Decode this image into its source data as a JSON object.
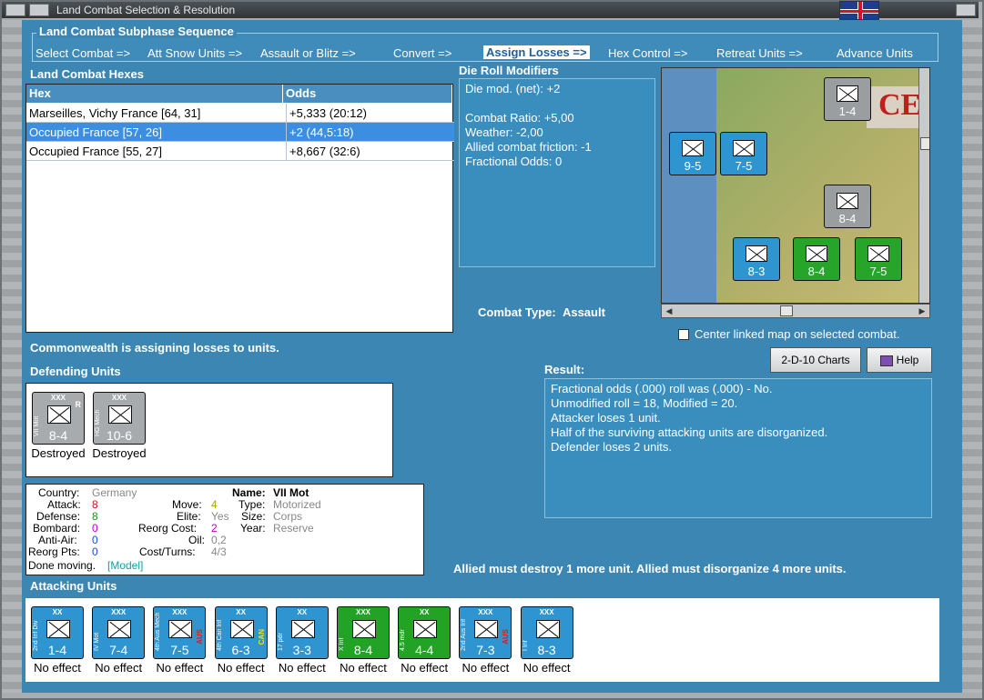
{
  "window": {
    "title": "Land Combat Selection & Resolution"
  },
  "sequence": {
    "title": "Land Combat Subphase Sequence",
    "steps": [
      "Select Combat =>",
      "Att Snow Units =>",
      "Assault or Blitz =>",
      "Convert =>",
      "Assign Losses =>",
      "Hex Control =>",
      "Retreat Units =>",
      "Advance Units"
    ],
    "active_index": 4
  },
  "hexes": {
    "title": "Land Combat Hexes",
    "columns": [
      "Hex",
      "Odds"
    ],
    "rows": [
      {
        "hex": "Marseilles, Vichy France [64, 31]",
        "odds": "+5,333 (20:12)",
        "selected": false
      },
      {
        "hex": "Occupied France [57, 26]",
        "odds": "+2 (44,5:18)",
        "selected": true
      },
      {
        "hex": "Occupied France [55, 27]",
        "odds": "+8,667 (32:6)",
        "selected": false
      }
    ]
  },
  "die": {
    "title": "Die Roll Modifiers",
    "lines": [
      "Die mod. (net): +2",
      "",
      "Combat Ratio: +5,00",
      "Weather: -2,00",
      "Allied combat friction: -1",
      "Fractional Odds: 0"
    ]
  },
  "combat_type": {
    "label": "Combat Type:",
    "value": "Assault"
  },
  "center_map": {
    "label": "Center linked map on selected combat.",
    "checked": false
  },
  "buttons": {
    "charts": "2-D-10 Charts",
    "help": "Help"
  },
  "status_msg": "Commonwealth is assigning losses to units.",
  "result": {
    "title": "Result:",
    "lines": [
      "Fractional odds (.000) roll was (.000)  - No.",
      "Unmodified roll = 18, Modified = 20.",
      "Attacker loses 1 unit.",
      "Half of the surviving attacking units are disorganized.",
      "Defender loses 2 units."
    ]
  },
  "defending": {
    "title": "Defending Units",
    "units": [
      {
        "name": "VII Mot",
        "size": "XXX",
        "value": "8-4",
        "status": "Destroyed",
        "tag": "R"
      },
      {
        "name": "HG Mech",
        "size": "XXX",
        "value": "10-6",
        "status": "Destroyed",
        "tag": ""
      }
    ]
  },
  "info": {
    "country_label": "Country:",
    "country": "Germany",
    "attack_label": "Attack:",
    "attack": "8",
    "defense_label": "Defense:",
    "defense": "8",
    "bombard_label": "Bombard:",
    "bombard": "0",
    "antiair_label": "Anti-Air:",
    "antiair": "0",
    "reorgpts_label": "Reorg Pts:",
    "reorgpts": "0",
    "move_label": "Move:",
    "move": "4",
    "elite_label": "Elite:",
    "elite": "Yes",
    "reorgcost_label": "Reorg Cost:",
    "reorgcost": "2",
    "oil_label": "Oil:",
    "oil": "0,2",
    "costturns_label": "Cost/Turns:",
    "costturns": "4/3",
    "name_label": "Name:",
    "name": "VII Mot",
    "type_label": "Type:",
    "type": "Motorized",
    "size_label": "Size:",
    "size": "Corps",
    "year_label": "Year:",
    "year": "Reserve",
    "done": "Done moving.",
    "model": "[Model]"
  },
  "must_msg": "Allied must destroy 1 more unit. Allied must disorganize 4 more units.",
  "attacking": {
    "title": "Attacking Units",
    "units": [
      {
        "name": "2nd Inf Div",
        "size": "XX",
        "value": "1-4",
        "status": "No effect",
        "color": "b",
        "nat": ""
      },
      {
        "name": "IV Mot",
        "size": "XXX",
        "value": "7-4",
        "status": "No effect",
        "color": "b",
        "nat": ""
      },
      {
        "name": "4th Aus Mech",
        "size": "XXX",
        "value": "7-5",
        "status": "No effect",
        "color": "b",
        "nat": "AUS"
      },
      {
        "name": "4th Can Inf",
        "size": "XX",
        "value": "6-3",
        "status": "No effect",
        "color": "b",
        "nat": "CAN"
      },
      {
        "name": "17 pdr",
        "size": "XX",
        "value": "3-3",
        "status": "No effect",
        "color": "b",
        "nat": ""
      },
      {
        "name": "X Inf",
        "size": "XXX",
        "value": "8-4",
        "status": "No effect",
        "color": "gr",
        "nat": ""
      },
      {
        "name": "4.5 mdr",
        "size": "XX",
        "value": "4-4",
        "status": "No effect",
        "color": "gr",
        "nat": ""
      },
      {
        "name": "2nd Aus Inf",
        "size": "XXX",
        "value": "7-3",
        "status": "No effect",
        "color": "b",
        "nat": "AUS"
      },
      {
        "name": "I Inf",
        "size": "XXX",
        "value": "8-3",
        "status": "No effect",
        "color": "b",
        "nat": ""
      }
    ]
  },
  "map": {
    "counters": [
      {
        "label": "9-5",
        "color": "b"
      },
      {
        "label": "7-5",
        "color": "b"
      },
      {
        "label": "1-4",
        "color": "g"
      },
      {
        "label": "8-3",
        "color": "b"
      },
      {
        "label": "8-4",
        "color": "gr"
      },
      {
        "label": "7-5",
        "color": "gr"
      },
      {
        "label": "8-4",
        "color": "g"
      }
    ]
  }
}
